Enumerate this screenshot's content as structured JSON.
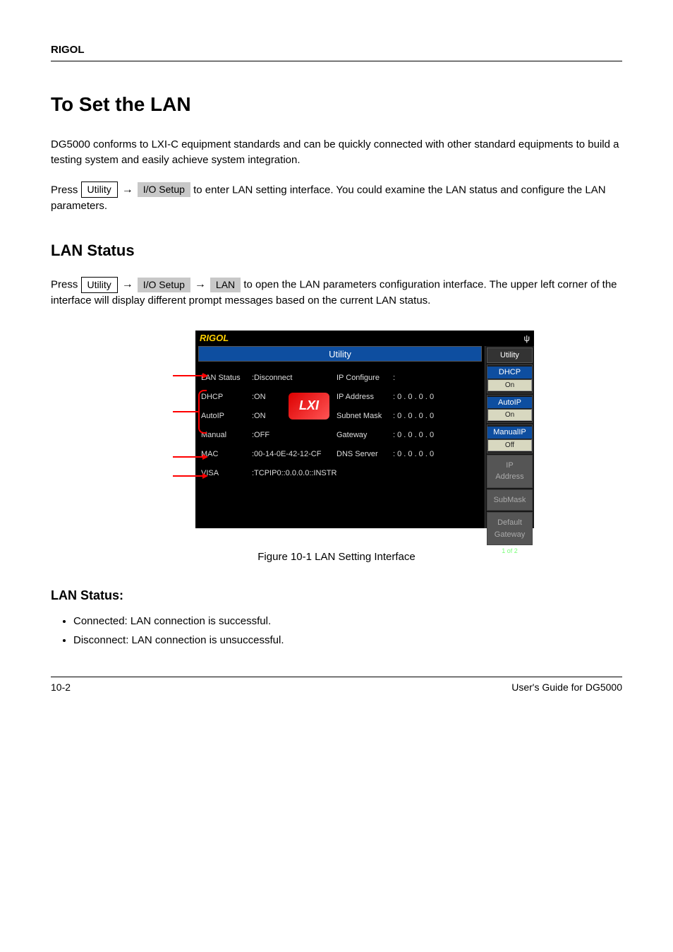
{
  "header": {
    "brand": "RIGOL"
  },
  "title": "To Set the LAN",
  "intro": "DG5000 conforms to LXI-C equipment standards and can be quickly connected with other standard equipments to build a testing system and easily achieve system integration.",
  "instruction1_pre": "Press ",
  "instruction1_post": " to enter LAN setting interface. You could examine the LAN status and configure the LAN parameters.",
  "utility_btn": "Utility",
  "iosetup_btn": "I/O Setup",
  "lan_btn": "LAN",
  "section1": {
    "title": "LAN Status",
    "para_pre": "Press ",
    "para_mid": " to open the LAN parameters configuration interface. The upper left corner of the interface will display different prompt messages based on the current LAN status.",
    "path_arrow": "→"
  },
  "screenshot": {
    "brand": "RIGOL",
    "title_bar": "Utility",
    "side_menu_title": "Utility",
    "rows": [
      {
        "label": "LAN Status",
        "val": ":Disconnect"
      },
      {
        "label": "DHCP",
        "val": ":ON"
      },
      {
        "label": "AutoIP",
        "val": ":ON"
      },
      {
        "label": "Manual",
        "val": ":OFF"
      },
      {
        "label": "MAC",
        "val": ":00-14-0E-42-12-CF"
      },
      {
        "label": "VISA",
        "val": ":TCPIP0::0.0.0.0::INSTR"
      }
    ],
    "right_rows": [
      {
        "label": "IP Configure",
        "val": ":"
      },
      {
        "label": "IP Address",
        "val": ":   0   .   0   .   0   .   0"
      },
      {
        "label": "Subnet Mask",
        "val": ":   0   .   0   .   0   .   0"
      },
      {
        "label": "Gateway",
        "val": ":   0   .   0   .   0   .   0"
      },
      {
        "label": "DNS Server",
        "val": ":   0   .   0   .   0   .   0"
      }
    ],
    "lxi": "LXI",
    "menu": [
      {
        "title": "DHCP",
        "val": "On",
        "hl": true
      },
      {
        "title": "AutoIP",
        "val": "On",
        "hl": true
      },
      {
        "title": "ManualIP",
        "val": "Off",
        "hl": true
      },
      {
        "title": "IP\nAddress",
        "grey": true
      },
      {
        "title": "SubMask",
        "grey": true
      },
      {
        "title": "Default\nGateway",
        "grey": true
      }
    ],
    "page_ind": "1 of 2"
  },
  "figure_caption": "Figure 10-1 LAN Setting Interface",
  "subsection": {
    "title": "LAN Status:",
    "items": [
      "Connected: LAN connection is successful.",
      "Disconnect: LAN connection is unsuccessful."
    ]
  },
  "footer": {
    "page": "10-2",
    "doc": "User's Guide for DG5000"
  }
}
